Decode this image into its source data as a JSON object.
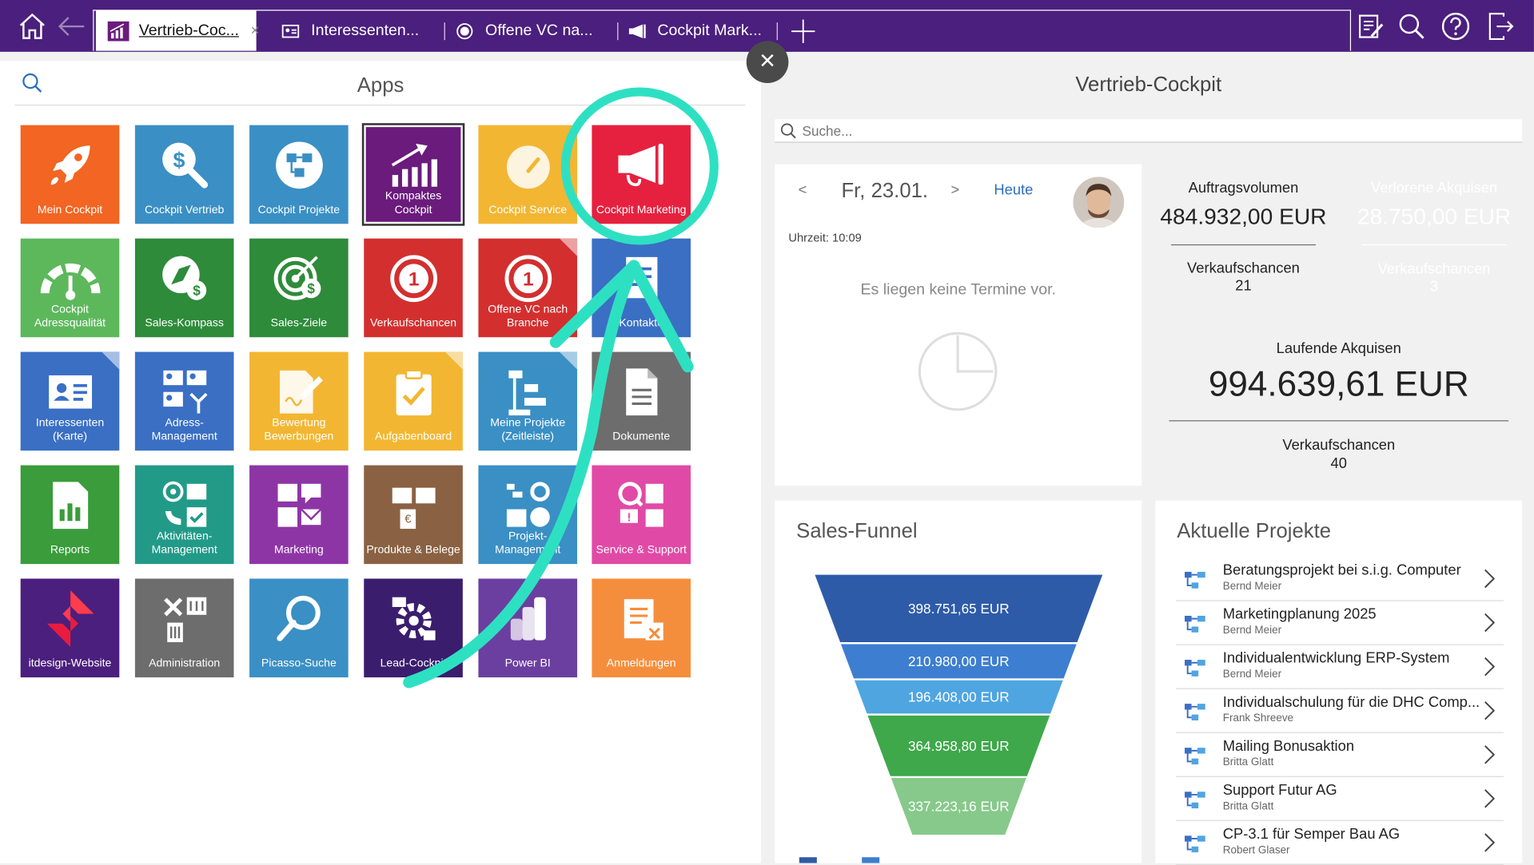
{
  "tabs": [
    {
      "label": "Vertrieb-Coc...",
      "icon": "chart-bars-icon",
      "active": true
    },
    {
      "label": "Interessenten...",
      "icon": "contact-card-icon",
      "active": false
    },
    {
      "label": "Offene VC na...",
      "icon": "circle-number-icon",
      "active": false
    },
    {
      "label": "Cockpit Mark...",
      "icon": "megaphone-icon",
      "active": false
    }
  ],
  "tab_close_glyph": "×",
  "apps": {
    "title": "Apps",
    "tiles": [
      {
        "label": "Mein Cockpit",
        "icon": "rocket-icon",
        "color": "#f26522"
      },
      {
        "label": "Cockpit Vertrieb",
        "icon": "dollar-search-icon",
        "color": "#3a8fc4"
      },
      {
        "label": "Cockpit Projekte",
        "icon": "project-nodes-icon",
        "color": "#3a8fc4"
      },
      {
        "label": "Kompaktes Cockpit",
        "icon": "growth-chart-icon",
        "color": "#6a1b7c"
      },
      {
        "label": "Cockpit Service",
        "icon": "gauge-icon",
        "color": "#f2b632"
      },
      {
        "label": "Cockpit Marketing",
        "icon": "megaphone-icon",
        "color": "#e6213f"
      },
      {
        "label": "Cockpit Adressqualität",
        "icon": "speedometer-icon",
        "color": "#5db85c"
      },
      {
        "label": "Sales-Kompass",
        "icon": "compass-dollar-icon",
        "color": "#2e8b3a"
      },
      {
        "label": "Sales-Ziele",
        "icon": "target-dollar-icon",
        "color": "#2e8b3a"
      },
      {
        "label": "Verkaufschancen",
        "icon": "number-one-icon",
        "color": "#d32f2f"
      },
      {
        "label": "Offene VC nach Branche",
        "icon": "number-one-icon",
        "color": "#d32f2f"
      },
      {
        "label": "Kontakte",
        "icon": "document-list-icon",
        "color": "#3a6fc4"
      },
      {
        "label": "Interessenten (Karte)",
        "icon": "contact-card-icon",
        "color": "#3a6fc4"
      },
      {
        "label": "Adress-Management",
        "icon": "address-cards-icon",
        "color": "#3a6fc4"
      },
      {
        "label": "Bewertung Bewerbungen",
        "icon": "document-pen-icon",
        "color": "#f2b632"
      },
      {
        "label": "Aufgabenboard",
        "icon": "clipboard-check-icon",
        "color": "#f2b632"
      },
      {
        "label": "Meine Projekte (Zeitleiste)",
        "icon": "timeline-icon",
        "color": "#3a8fc4"
      },
      {
        "label": "Dokumente",
        "icon": "document-icon",
        "color": "#6d6d6d"
      },
      {
        "label": "Reports",
        "icon": "report-chart-icon",
        "color": "#3a9c3a"
      },
      {
        "label": "Aktivitäten-Management",
        "icon": "activity-icons-icon",
        "color": "#229a88"
      },
      {
        "label": "Marketing",
        "icon": "marketing-icons-icon",
        "color": "#8e35a6"
      },
      {
        "label": "Produkte & Belege",
        "icon": "products-icon",
        "color": "#8a6142"
      },
      {
        "label": "Projekt-Management",
        "icon": "project-mgmt-icon",
        "color": "#3a8fc4"
      },
      {
        "label": "Service & Support",
        "icon": "service-support-icon",
        "color": "#e04aa6"
      },
      {
        "label": "itdesign-Website",
        "icon": "itdesign-logo-icon",
        "color": "#4b1f7d"
      },
      {
        "label": "Administration",
        "icon": "admin-tools-icon",
        "color": "#6d6d6d"
      },
      {
        "label": "Picasso-Suche",
        "icon": "magnifier-icon",
        "color": "#3a8fc4"
      },
      {
        "label": "Lead-Cockpit",
        "icon": "lead-gear-icon",
        "color": "#3b1d6e"
      },
      {
        "label": "Power BI",
        "icon": "power-bi-icon",
        "color": "#6b3fa0"
      },
      {
        "label": "Anmeldungen",
        "icon": "registration-icon",
        "color": "#f58e3c"
      }
    ]
  },
  "close_glyph": "×",
  "cockpit": {
    "title": "Vertrieb-Cockpit",
    "search_placeholder": "Suche...",
    "calendar": {
      "prev": "<",
      "date": "Fr, 23.01.",
      "next": ">",
      "today": "Heute",
      "time": "Uhrzeit: 10:09",
      "empty": "Es liegen keine Termine vor."
    },
    "kpis": {
      "auftragsvolumen": {
        "title": "Auftragsvolumen",
        "value": "484.932,00 EUR",
        "sub_label": "Verkaufschancen",
        "sub_value": "21",
        "color": "#3aa93f"
      },
      "verlorene": {
        "title": "Verlorene Akquisen",
        "value": "28.750,00 EUR",
        "sub_label": "Verkaufschancen",
        "sub_value": "3",
        "color": "#e03440"
      },
      "laufende": {
        "title": "Laufende Akquisen",
        "value": "994.639,61 EUR",
        "sub_label": "Verkaufschancen",
        "sub_value": "40",
        "color": "#f6be2a"
      }
    },
    "funnel": {
      "title": "Sales-Funnel",
      "stages": [
        {
          "value": "398.751,65 EUR",
          "color": "#2e5ba8"
        },
        {
          "value": "210.980,00 EUR",
          "color": "#3d7ed0"
        },
        {
          "value": "196.408,00 EUR",
          "color": "#4fa5e0"
        },
        {
          "value": "364.958,80 EUR",
          "color": "#3ea84a"
        },
        {
          "value": "337.223,16 EUR",
          "color": "#86c98a"
        }
      ]
    },
    "projects": {
      "title": "Aktuelle Projekte",
      "items": [
        {
          "title": "Beratungsprojekt bei s.i.g. Computer",
          "owner": "Bernd Meier"
        },
        {
          "title": "Marketingplanung 2025",
          "owner": "Bernd Meier"
        },
        {
          "title": "Individualentwicklung ERP-System",
          "owner": "Bernd Meier"
        },
        {
          "title": "Individualschulung für die DHC Comp...",
          "owner": "Frank Shreeve"
        },
        {
          "title": "Mailing Bonusaktion",
          "owner": "Britta Glatt"
        },
        {
          "title": "Support Futur AG",
          "owner": "Britta Glatt"
        },
        {
          "title": "CP-3.1 für Semper Bau AG",
          "owner": "Robert Glaser"
        }
      ]
    }
  },
  "annotation_color": "#2ee0c2"
}
